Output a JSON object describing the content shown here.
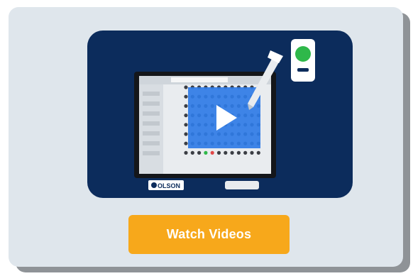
{
  "card": {
    "background": "#dfe6ec",
    "shadow": "#8f9397"
  },
  "thumbnail": {
    "background": "#0c2c5c",
    "accent_blue": "#2f7be6",
    "play_icon": "play-icon",
    "logo_text": "OLSON"
  },
  "cta": {
    "label": "Watch Videos",
    "color": "#f7a81b"
  }
}
